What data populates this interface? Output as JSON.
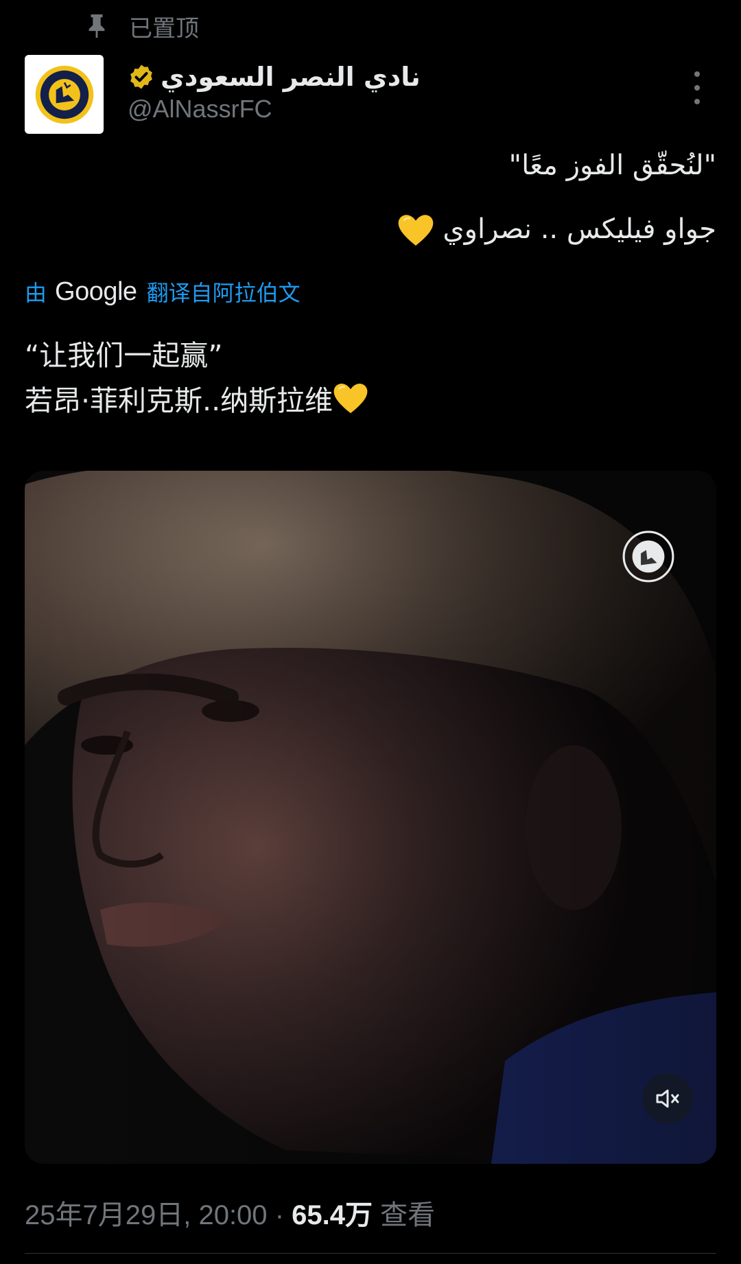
{
  "pinned": {
    "label": "已置顶"
  },
  "author": {
    "display_name": "نادي النصر السعودي",
    "handle": "@AlNassrFC",
    "verified": true,
    "badge_color": "#e2b719",
    "avatar_logo_name": "NASSR"
  },
  "tweet": {
    "original_lines": [
      "\"لنُحقّق الفوز معًا\"",
      "جواو فيليكس .. نصراوي"
    ],
    "translation": {
      "prefix": "由",
      "provider": "Google",
      "suffix": "翻译自阿拉伯文"
    },
    "translated_lines": [
      "“让我们一起赢”",
      "若昂·菲利克斯..纳斯拉维"
    ],
    "emoji": "yellow-heart-icon"
  },
  "media": {
    "type": "video",
    "watermark_name": "NASSR",
    "muted": true
  },
  "meta": {
    "date_time": "25年7月29日, 20:00",
    "separator": "·",
    "views_count": "65.4万",
    "views_label": "查看"
  },
  "colors": {
    "background": "#000000",
    "text_primary": "#e7e9ea",
    "text_secondary": "#71767b",
    "link": "#1d9bf0",
    "club_navy": "#13204a",
    "club_gold": "#f2c21a"
  }
}
